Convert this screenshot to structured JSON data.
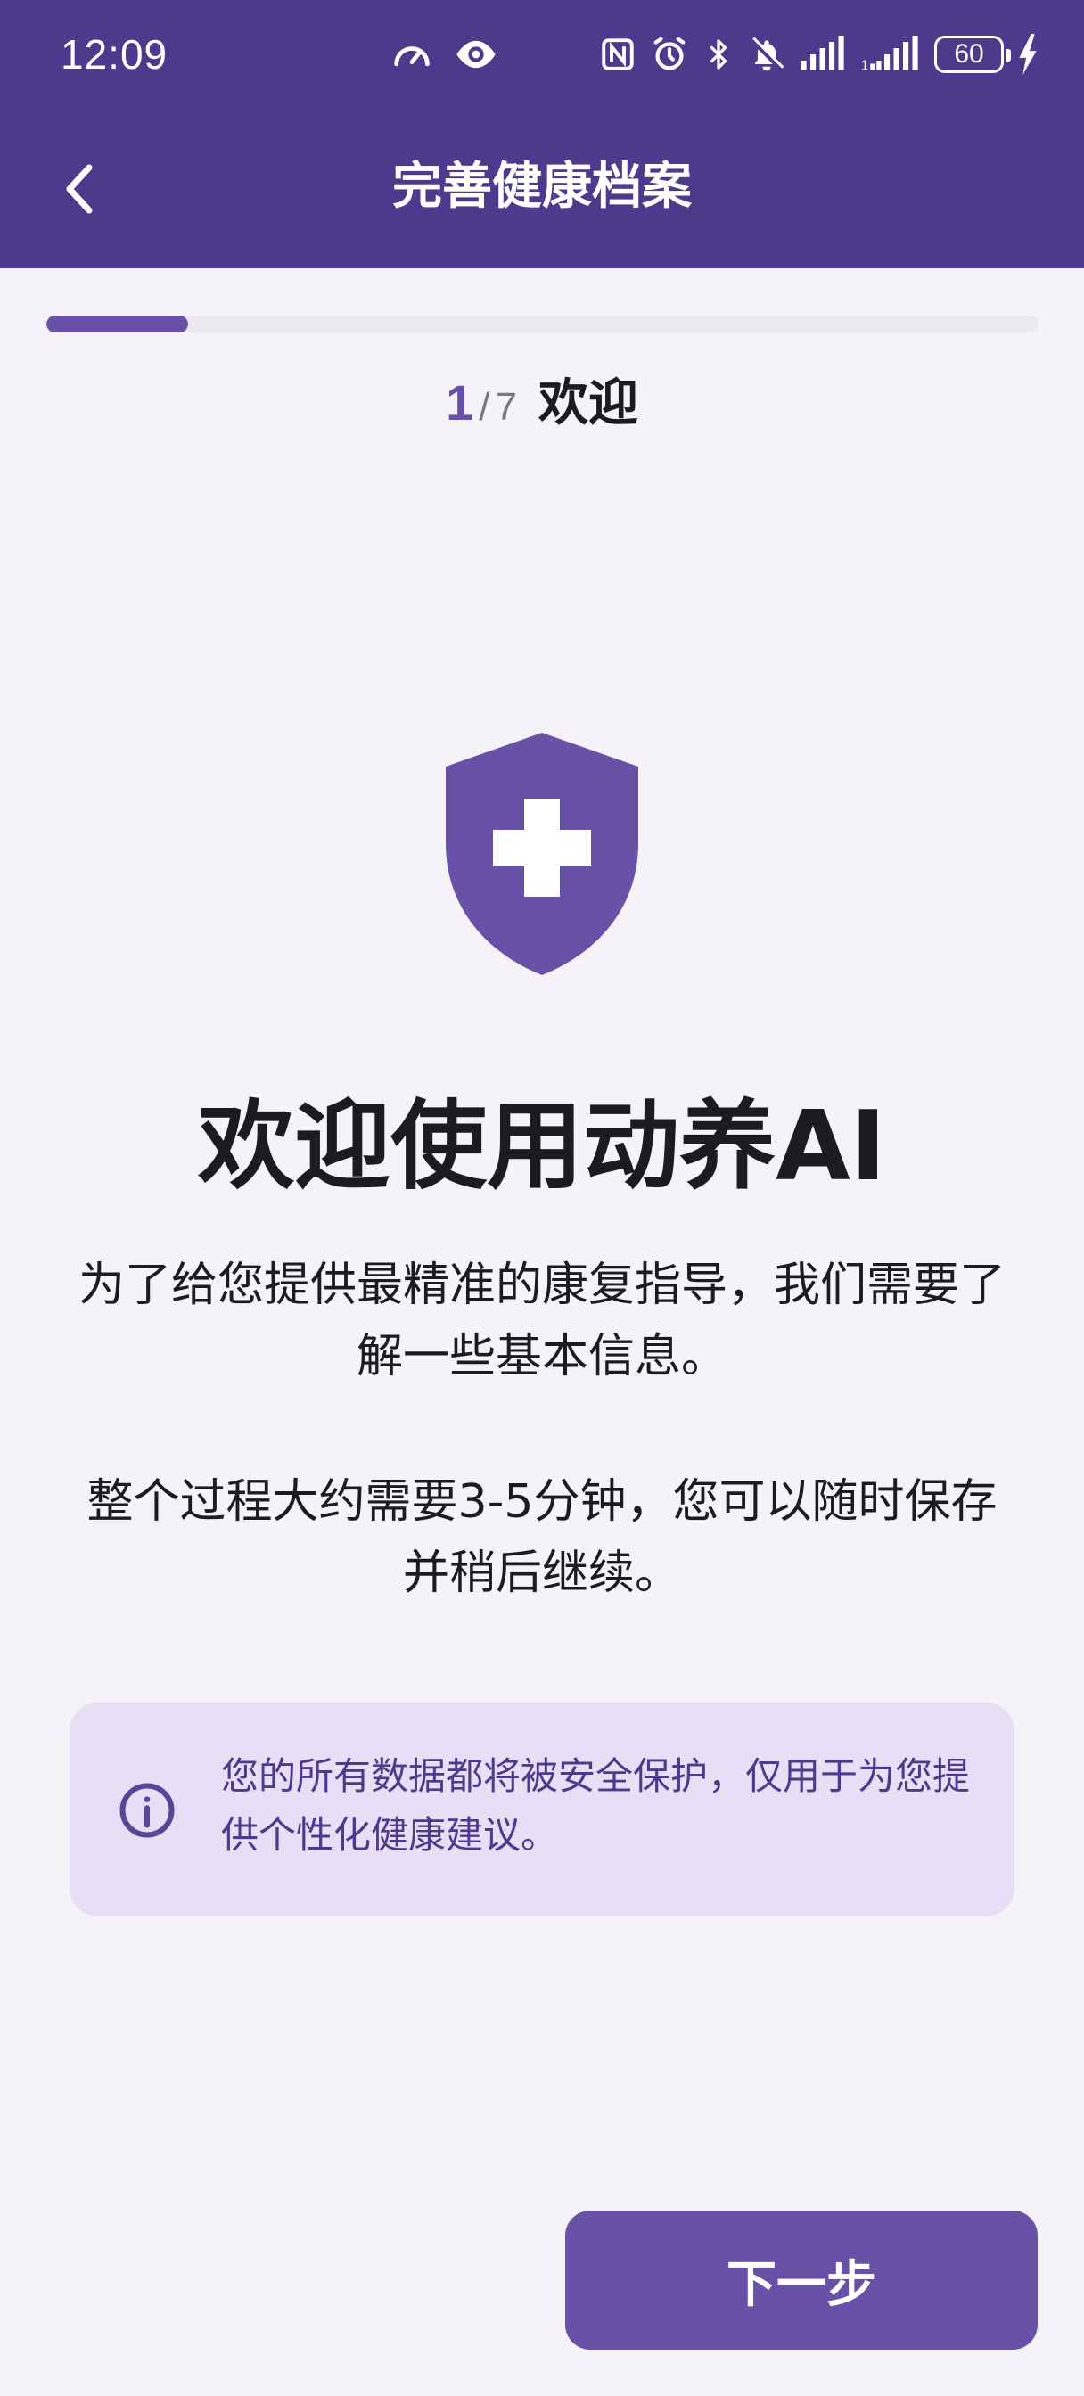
{
  "status_bar": {
    "time": "12:09",
    "battery": "60",
    "icons": [
      "speedometer-icon",
      "eye-icon",
      "nfc-icon",
      "alarm-icon",
      "bluetooth-icon",
      "bell-muted-icon",
      "signal-icon",
      "signal-icon",
      "battery-icon",
      "charging-icon"
    ]
  },
  "header": {
    "title": "完善健康档案",
    "back_icon": "chevron-left-icon"
  },
  "progress": {
    "current": "1",
    "separator": "/",
    "total": "7",
    "step_name": "欢迎",
    "fraction": 0.142857
  },
  "welcome": {
    "icon": "shield-plus-icon",
    "title": "欢迎使用动养AI",
    "description_1": "为了给您提供最精准的康复指导，我们需要了解一些基本信息。",
    "description_2": "整个过程大约需要3-5分钟，您可以随时保存并稍后继续。"
  },
  "info_card": {
    "icon": "info-icon",
    "text": "您的所有数据都将被安全保护，仅用于为您提供个性化健康建议。"
  },
  "footer": {
    "next_label": "下一步"
  },
  "colors": {
    "primary": "#4e3a8c",
    "accent": "#6851a6",
    "info_bg": "#e8dff6",
    "page_bg": "#f5f3f8"
  }
}
